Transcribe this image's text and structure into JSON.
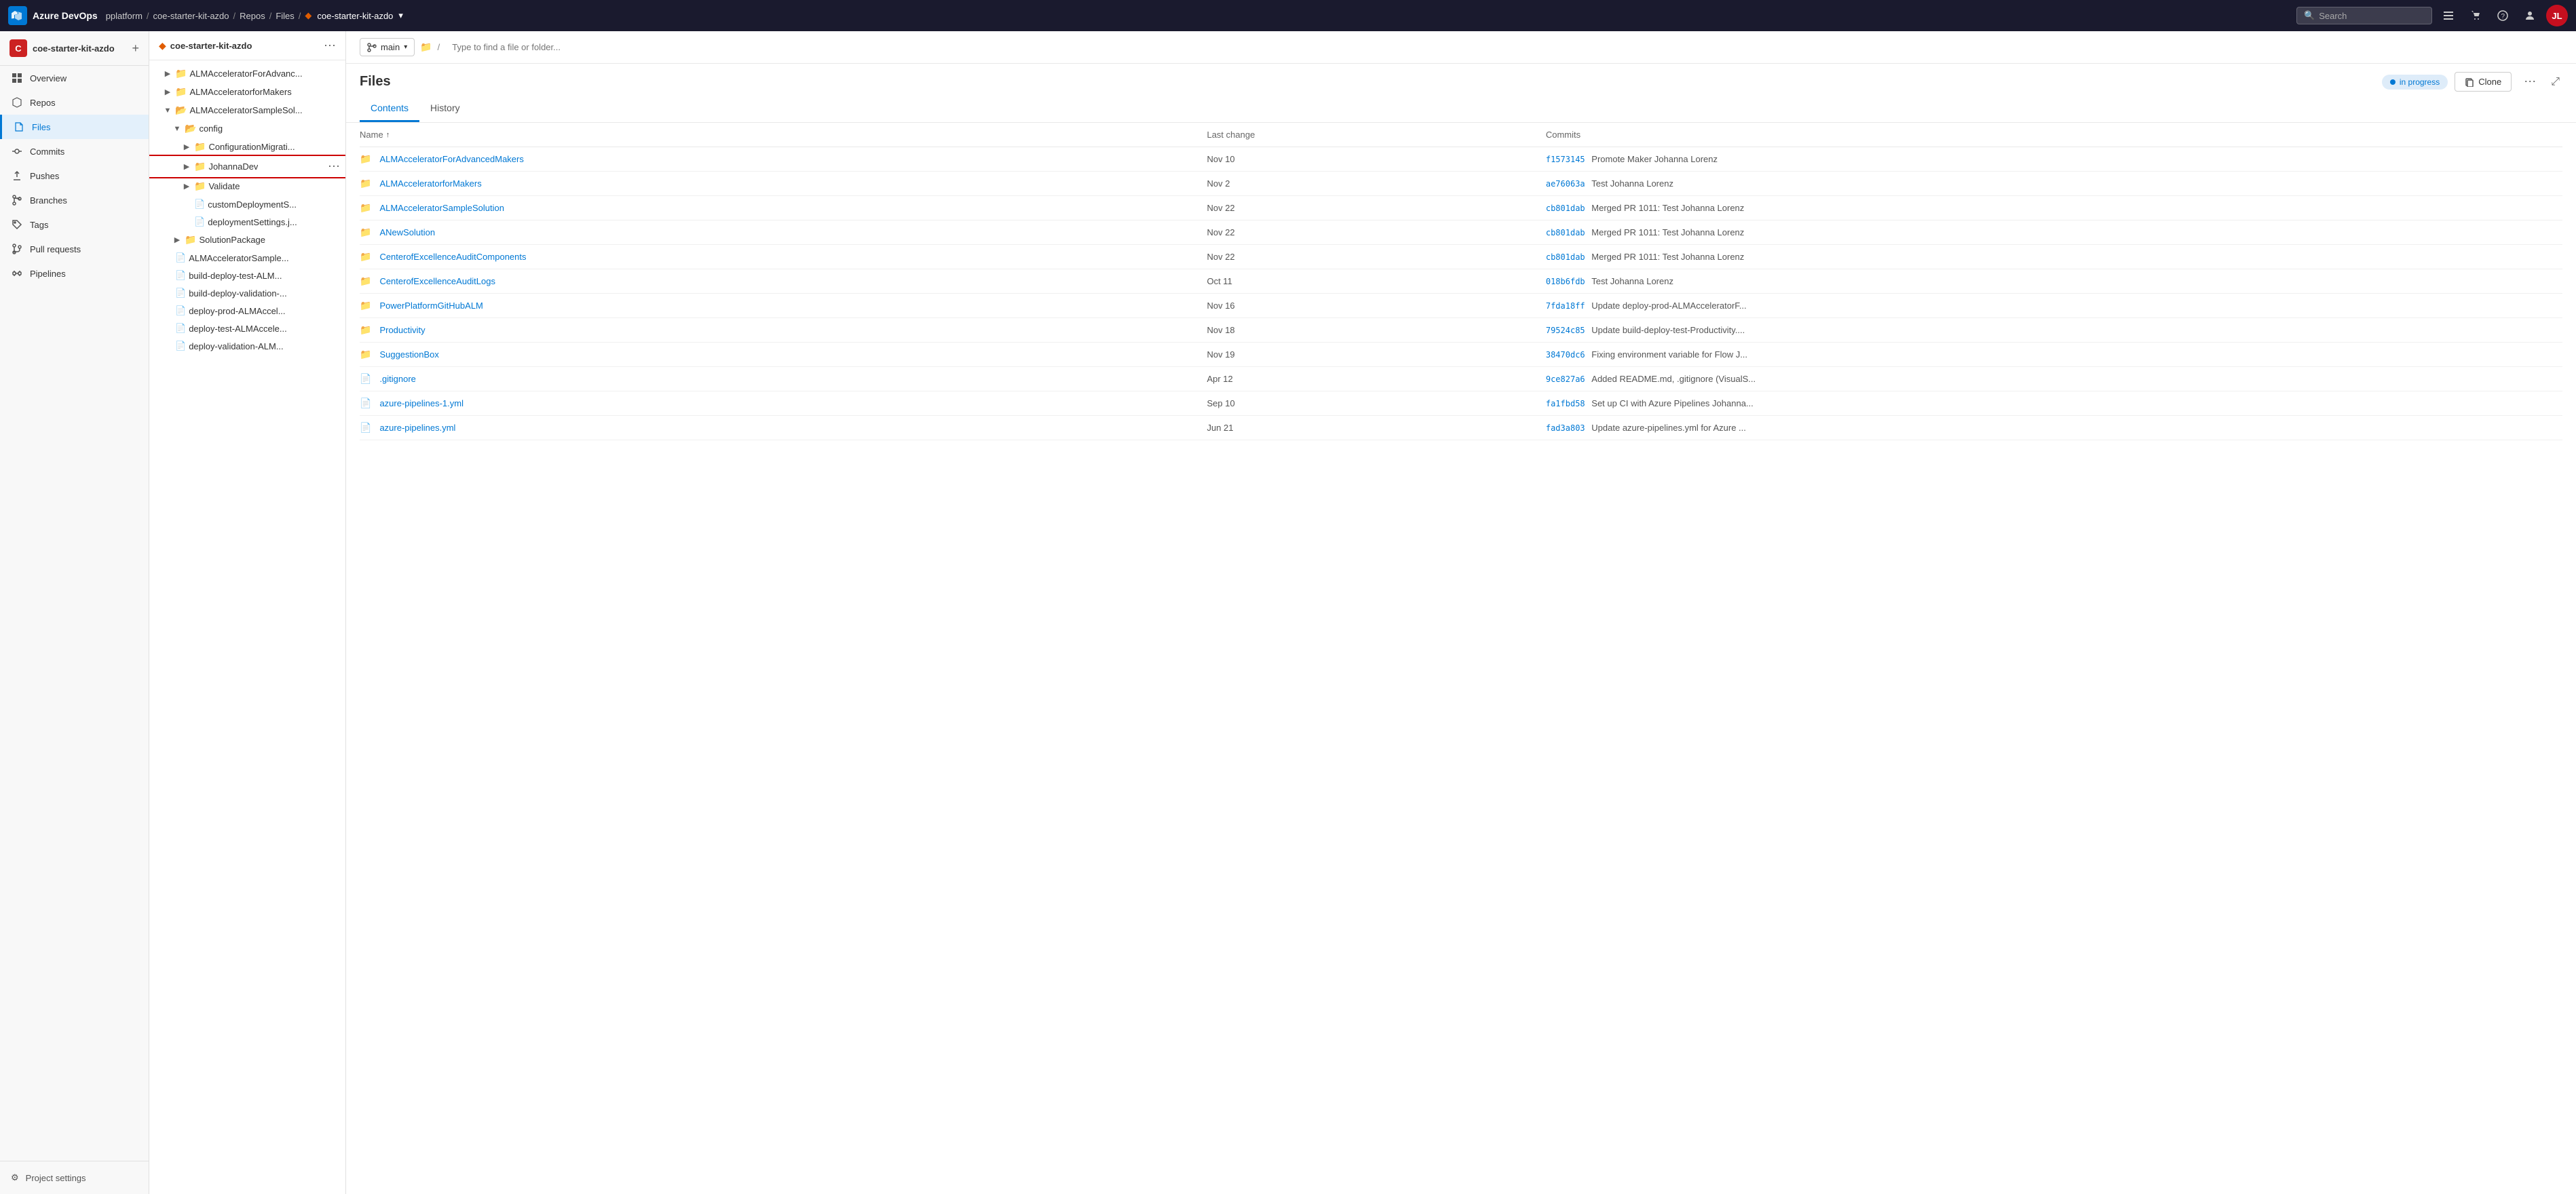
{
  "topNav": {
    "logoText": "Azure DevOps",
    "breadcrumb": [
      {
        "label": "pplatform",
        "href": "#"
      },
      {
        "label": "coe-starter-kit-azdo",
        "href": "#"
      },
      {
        "label": "Repos",
        "href": "#"
      },
      {
        "label": "Files",
        "href": "#"
      },
      {
        "label": "coe-starter-kit-azdo",
        "href": "#",
        "hasDropdown": true
      }
    ],
    "searchPlaceholder": "Search",
    "avatarInitials": "JL"
  },
  "sidebar": {
    "orgIcon": "C",
    "orgName": "coe-starter-kit-azdo",
    "addBtn": "+",
    "navItems": [
      {
        "label": "Overview",
        "icon": "overview",
        "active": false
      },
      {
        "label": "Repos",
        "icon": "repos",
        "active": false
      },
      {
        "label": "Files",
        "icon": "files",
        "active": true
      },
      {
        "label": "Commits",
        "icon": "commits",
        "active": false
      },
      {
        "label": "Pushes",
        "icon": "pushes",
        "active": false
      },
      {
        "label": "Branches",
        "icon": "branches",
        "active": false
      },
      {
        "label": "Tags",
        "icon": "tags",
        "active": false
      },
      {
        "label": "Pull requests",
        "icon": "pullrequests",
        "active": false
      },
      {
        "label": "Pipelines",
        "icon": "pipelines",
        "active": false
      }
    ],
    "bottomItems": [
      {
        "label": "Project settings"
      }
    ]
  },
  "fileTree": {
    "repoName": "coe-starter-kit-azdo",
    "items": [
      {
        "level": 1,
        "type": "folder",
        "label": "ALMAcceleratorForAdvanc...",
        "expanded": false,
        "chevron": "right"
      },
      {
        "level": 1,
        "type": "folder",
        "label": "ALMAcceleratorforMakers",
        "expanded": false,
        "chevron": "right"
      },
      {
        "level": 1,
        "type": "folder",
        "label": "ALMAcceleratorSampleSol...",
        "expanded": true,
        "chevron": "down"
      },
      {
        "level": 2,
        "type": "folder",
        "label": "config",
        "expanded": true,
        "chevron": "down"
      },
      {
        "level": 3,
        "type": "folder",
        "label": "ConfigurationMigrati...",
        "expanded": false,
        "chevron": "right"
      },
      {
        "level": 3,
        "type": "folder",
        "label": "JohannaDev",
        "expanded": false,
        "chevron": "right",
        "highlighted": true
      },
      {
        "level": 3,
        "type": "folder",
        "label": "Validate",
        "expanded": false,
        "chevron": "right"
      },
      {
        "level": 3,
        "type": "file",
        "label": "customDeploymentS...",
        "expanded": false
      },
      {
        "level": 3,
        "type": "file",
        "label": "deploymentSettings.j...",
        "expanded": false
      },
      {
        "level": 2,
        "type": "folder",
        "label": "SolutionPackage",
        "expanded": false,
        "chevron": "right"
      },
      {
        "level": 1,
        "type": "file",
        "label": "ALMAcceleratorSample...",
        "expanded": false
      },
      {
        "level": 1,
        "type": "file",
        "label": "build-deploy-test-ALM...",
        "expanded": false
      },
      {
        "level": 1,
        "type": "file",
        "label": "build-deploy-validation-...",
        "expanded": false
      },
      {
        "level": 1,
        "type": "file",
        "label": "deploy-prod-ALMAccel...",
        "expanded": false
      },
      {
        "level": 1,
        "type": "file",
        "label": "deploy-test-ALMAccele...",
        "expanded": false
      },
      {
        "level": 1,
        "type": "file",
        "label": "deploy-validation-ALM...",
        "expanded": false
      }
    ]
  },
  "contentArea": {
    "branch": "main",
    "pathPlaceholder": "Type to find a file or folder...",
    "title": "Files",
    "inProgressLabel": "in progress",
    "cloneLabel": "Clone",
    "expandLabel": "⤢",
    "tabs": [
      {
        "label": "Contents",
        "active": true
      },
      {
        "label": "History",
        "active": false
      }
    ],
    "tableHeaders": {
      "name": "Name",
      "lastChange": "Last change",
      "commits": "Commits"
    },
    "rows": [
      {
        "type": "folder",
        "name": "ALMAcceleratorForAdvancedMakers",
        "lastChange": "Nov 10",
        "commitHash": "f1573145",
        "commitMsg": "Promote Maker",
        "commitAuthor": "Johanna Lorenz"
      },
      {
        "type": "folder",
        "name": "ALMAcceleratorforMakers",
        "lastChange": "Nov 2",
        "commitHash": "ae76063a",
        "commitMsg": "Test",
        "commitAuthor": "Johanna Lorenz"
      },
      {
        "type": "folder",
        "name": "ALMAcceleratorSampleSolution",
        "lastChange": "Nov 22",
        "commitHash": "cb801dab",
        "commitMsg": "Merged PR 1011: Test",
        "commitAuthor": "Johanna Lorenz"
      },
      {
        "type": "folder",
        "name": "ANewSolution",
        "lastChange": "Nov 22",
        "commitHash": "cb801dab",
        "commitMsg": "Merged PR 1011: Test",
        "commitAuthor": "Johanna Lorenz"
      },
      {
        "type": "folder",
        "name": "CenterofExcellenceAuditComponents",
        "lastChange": "Nov 22",
        "commitHash": "cb801dab",
        "commitMsg": "Merged PR 1011: Test",
        "commitAuthor": "Johanna Lorenz"
      },
      {
        "type": "folder",
        "name": "CenterofExcellenceAuditLogs",
        "lastChange": "Oct 11",
        "commitHash": "018b6fdb",
        "commitMsg": "Test",
        "commitAuthor": "Johanna Lorenz"
      },
      {
        "type": "folder",
        "name": "PowerPlatformGitHubALM",
        "lastChange": "Nov 16",
        "commitHash": "7fda18ff",
        "commitMsg": "Update deploy-prod-ALMAcceleratorF...",
        "commitAuthor": ""
      },
      {
        "type": "folder",
        "name": "Productivity",
        "lastChange": "Nov 18",
        "commitHash": "79524c85",
        "commitMsg": "Update build-deploy-test-Productivity....",
        "commitAuthor": ""
      },
      {
        "type": "folder",
        "name": "SuggestionBox",
        "lastChange": "Nov 19",
        "commitHash": "38470dc6",
        "commitMsg": "Fixing environment variable for Flow J...",
        "commitAuthor": ""
      },
      {
        "type": "file",
        "name": ".gitignore",
        "lastChange": "Apr 12",
        "commitHash": "9ce827a6",
        "commitMsg": "Added README.md, .gitignore (VisualS...",
        "commitAuthor": ""
      },
      {
        "type": "file",
        "name": "azure-pipelines-1.yml",
        "lastChange": "Sep 10",
        "commitHash": "fa1fbd58",
        "commitMsg": "Set up CI with Azure Pipelines Johanna...",
        "commitAuthor": ""
      },
      {
        "type": "file",
        "name": "azure-pipelines.yml",
        "lastChange": "Jun 21",
        "commitHash": "fad3a803",
        "commitMsg": "Update azure-pipelines.yml for Azure ...",
        "commitAuthor": ""
      }
    ]
  }
}
